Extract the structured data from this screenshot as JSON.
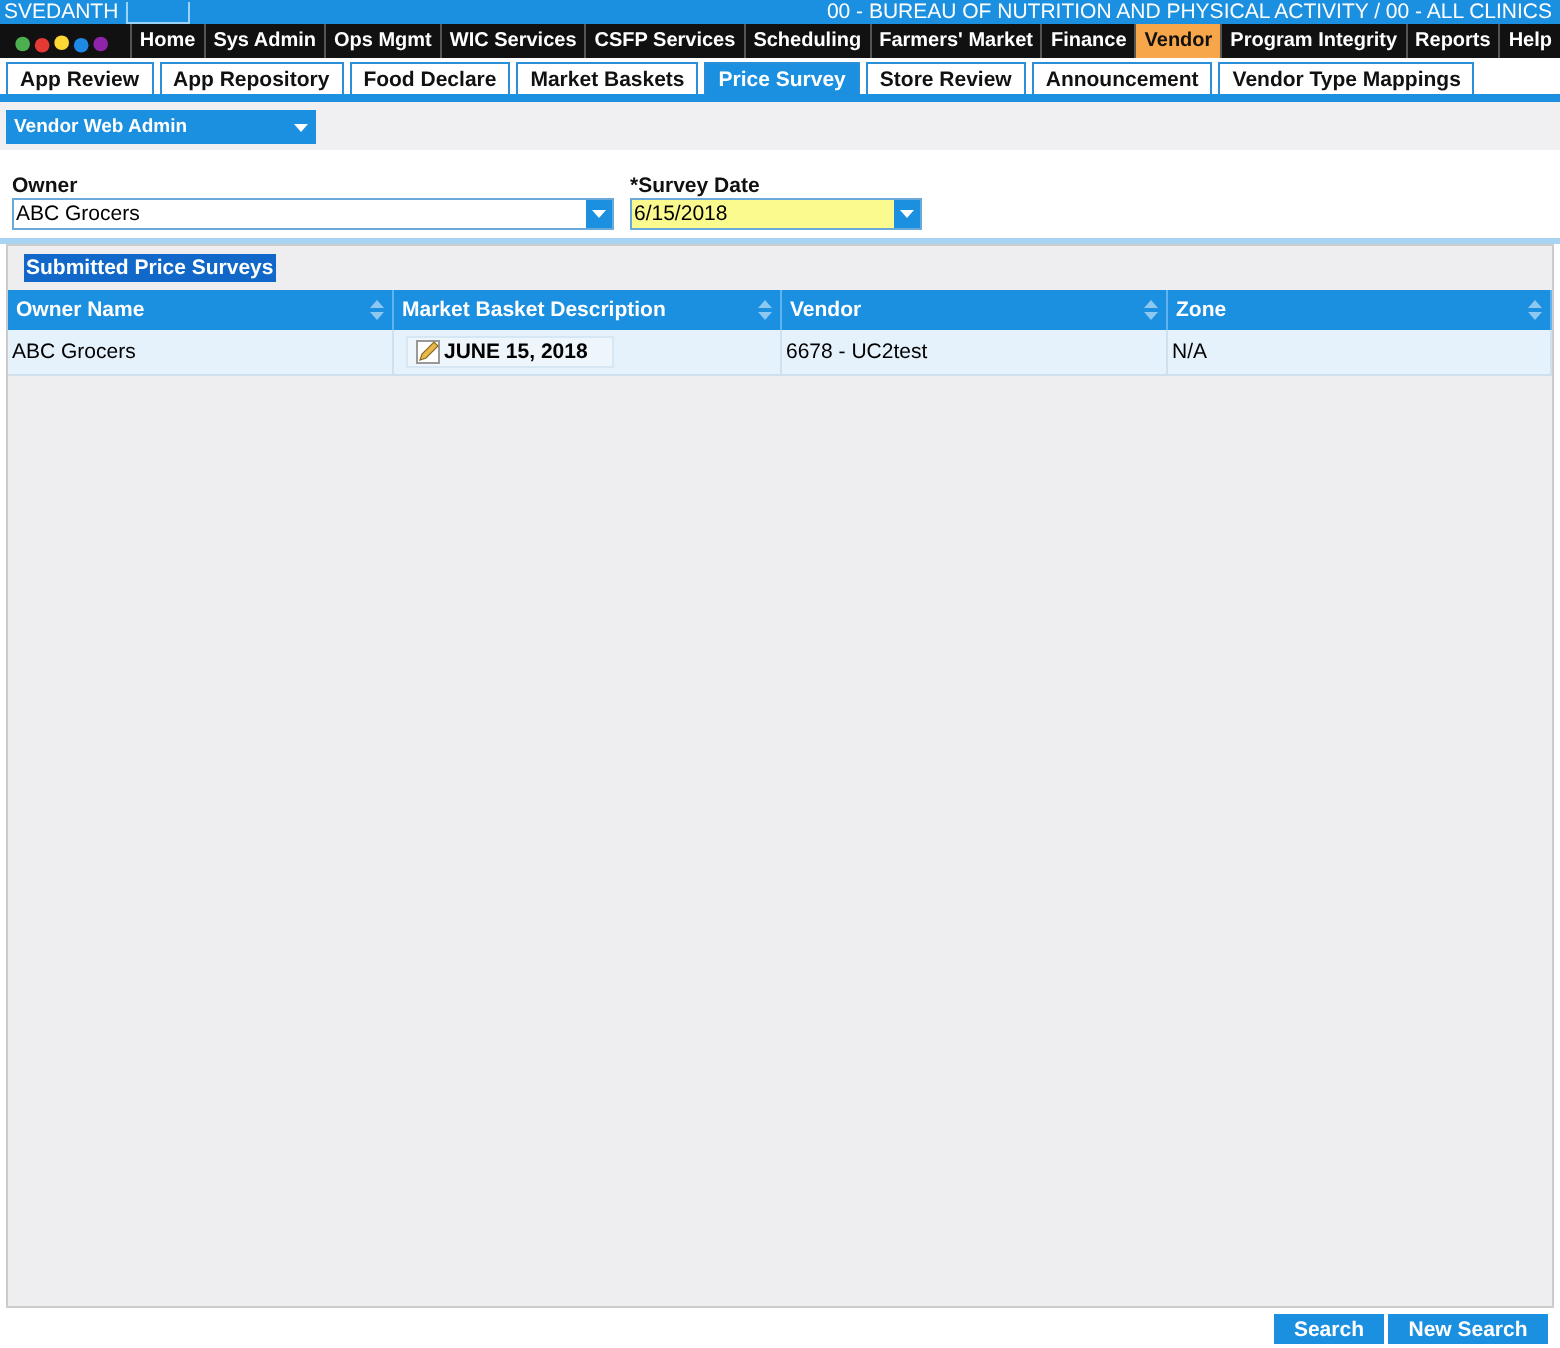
{
  "header": {
    "user": "SVEDANTH",
    "organization": "00 - BUREAU OF NUTRITION AND PHYSICAL ACTIVITY / 00 - ALL CLINICS"
  },
  "nav": [
    {
      "label": "Home",
      "selected": false
    },
    {
      "label": "Sys Admin",
      "selected": false
    },
    {
      "label": "Ops Mgmt",
      "selected": false
    },
    {
      "label": "WIC Services",
      "selected": false
    },
    {
      "label": "CSFP Services",
      "selected": false
    },
    {
      "label": "Scheduling",
      "selected": false
    },
    {
      "label": "Farmers' Market",
      "selected": false
    },
    {
      "label": "Finance",
      "selected": false
    },
    {
      "label": "Vendor",
      "selected": true
    },
    {
      "label": "Program Integrity",
      "selected": false
    },
    {
      "label": "Reports",
      "selected": false
    },
    {
      "label": "Help",
      "selected": false
    }
  ],
  "tabs": [
    {
      "label": "App Review",
      "selected": false
    },
    {
      "label": "App Repository",
      "selected": false
    },
    {
      "label": "Food Declare",
      "selected": false
    },
    {
      "label": "Market Baskets",
      "selected": false
    },
    {
      "label": "Price Survey",
      "selected": true
    },
    {
      "label": "Store Review",
      "selected": false
    },
    {
      "label": "Announcement",
      "selected": false
    },
    {
      "label": "Vendor Type Mappings",
      "selected": false
    }
  ],
  "menu_dropdown": {
    "value": "Vendor Web Admin"
  },
  "form": {
    "owner": {
      "label": "Owner",
      "value": "ABC Grocers"
    },
    "survey_date": {
      "label": "*Survey Date",
      "value": "6/15/2018"
    }
  },
  "section_title": "Submitted Price Surveys",
  "table": {
    "columns": [
      "Owner Name",
      "Market Basket Description",
      "Vendor",
      "Zone"
    ],
    "rows": [
      {
        "owner_name": "ABC Grocers",
        "description": "JUNE 15, 2018",
        "vendor": "6678 - UC2test",
        "zone": "N/A"
      }
    ]
  },
  "buttons": [
    "Search",
    "New Search"
  ]
}
